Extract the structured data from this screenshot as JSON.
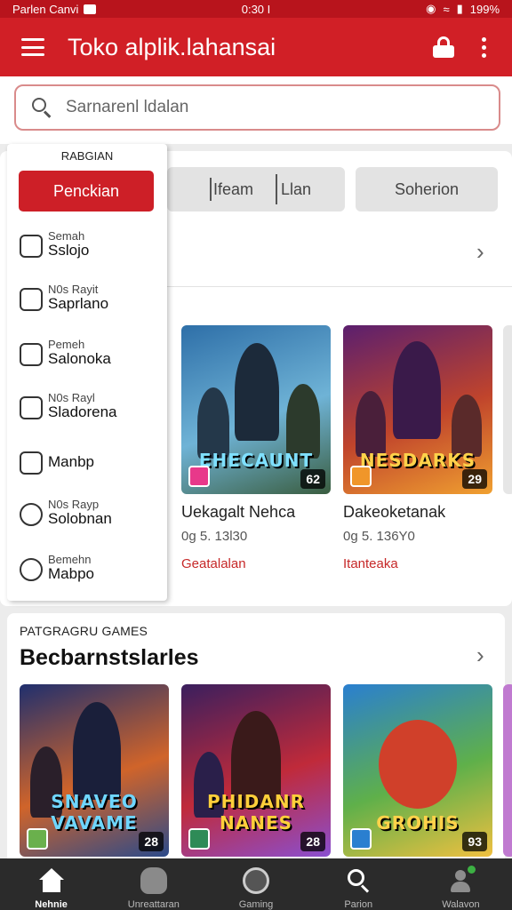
{
  "status_bar": {
    "carrier": "Parlen Canvi",
    "time": "0:30 I",
    "battery": "199%"
  },
  "app_bar": {
    "title": "Toko alplik.lahansai"
  },
  "search": {
    "placeholder": "Sarnarenl ldalan"
  },
  "tabs": [
    "Ifeam",
    "Llan",
    "Soherion"
  ],
  "featured_games": [
    {
      "title": "Uekagalt Nehca",
      "meta": "0g 5. 13l30",
      "category": "Geatalalan",
      "logo": "EHECAUNT",
      "rating": "62",
      "art_colors": [
        "#2e6fa8",
        "#6fb3d6",
        "#3a5d3f"
      ],
      "logo_color": "#7fe0ff"
    },
    {
      "title": "Dakeoketanak",
      "meta": "0g 5. 136Y0",
      "category": "Itanteaka",
      "logo": "NESDARKS",
      "rating": "29",
      "art_colors": [
        "#5b1f6e",
        "#c0442c",
        "#f0a030"
      ],
      "logo_color": "#ffd24a"
    }
  ],
  "section2": {
    "overline": "PATGRAGRU GAMES",
    "title": "Becbarnstslarles",
    "games": [
      {
        "logo": "SNAVEO VAVAME",
        "rating": "28",
        "art_colors": [
          "#1f2f6e",
          "#d0642a",
          "#2b4a8a"
        ],
        "logo_color": "#6fd6ff"
      },
      {
        "logo": "PHIDANR NANES",
        "rating": "28",
        "art_colors": [
          "#3a1f5e",
          "#c02a3a",
          "#8a4fd0"
        ],
        "logo_color": "#ffcf3a"
      },
      {
        "logo": "GROHIS",
        "rating": "93",
        "art_colors": [
          "#2a7fd0",
          "#5fb04a",
          "#f0c040"
        ],
        "logo_color": "#ffd24a"
      }
    ]
  },
  "drawer": {
    "header": "RABGIAN",
    "primary_button": "Penckian",
    "items": [
      {
        "sub": "Semah",
        "label": "Sslojo"
      },
      {
        "sub": "N0s Rayit",
        "label": "Saprlano"
      },
      {
        "sub": "Pemeh",
        "label": "Salonoka"
      },
      {
        "sub": "N0s Rayl",
        "label": "Sladorena"
      },
      {
        "sub": "",
        "label": "Manbp"
      },
      {
        "sub": "N0s Rayp",
        "label": "Solobnan"
      },
      {
        "sub": "Bemehn",
        "label": "Mabpo"
      }
    ]
  },
  "bottom_nav": [
    {
      "label": "Nehnie",
      "icon": "home-icon"
    },
    {
      "label": "Unreattaran",
      "icon": "apps-icon"
    },
    {
      "label": "Gaming",
      "icon": "games-icon"
    },
    {
      "label": "Parion",
      "icon": "search-icon"
    },
    {
      "label": "Walavon",
      "icon": "account-icon"
    }
  ],
  "colors": {
    "brand_red": "#d11f26",
    "status_red": "#b8141c",
    "nav_dark": "#2b2b2b"
  }
}
